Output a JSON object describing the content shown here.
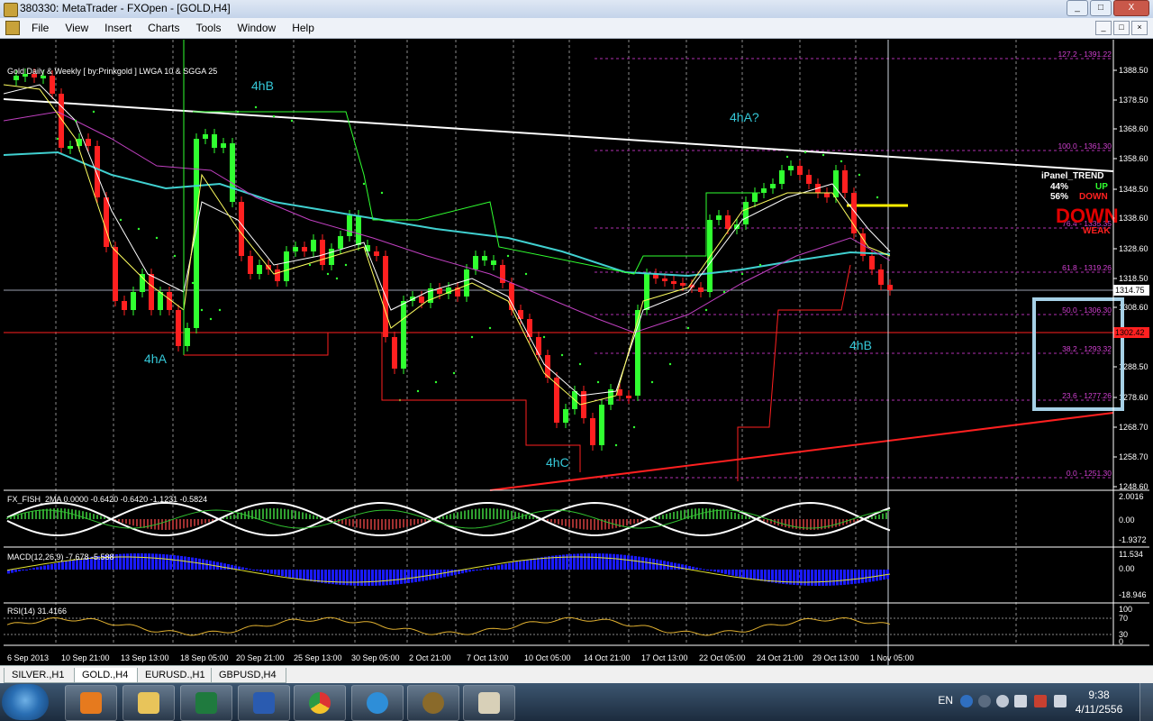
{
  "window": {
    "title": "380330: MetaTrader - FXOpen - [GOLD,H4]",
    "buttons": [
      "_",
      "□",
      "X"
    ]
  },
  "menu": {
    "items": [
      "File",
      "View",
      "Insert",
      "Charts",
      "Tools",
      "Window",
      "Help"
    ],
    "mdi_buttons": [
      "_",
      "□",
      "×"
    ]
  },
  "chart": {
    "header": "Gold Daily & Weekly [ by:Prinkgold ] LWGA 10  &  SGGA 25",
    "price_labels": [
      "1388.50",
      "1378.50",
      "1368.60",
      "1358.60",
      "1348.50",
      "1338.60",
      "1328.60",
      "1318.50",
      "1308.60",
      "1288.50",
      "1278.60",
      "1268.70",
      "1258.70",
      "1248.60"
    ],
    "current_price": "1314.75",
    "red_price_tag": "1302.42",
    "fib_labels": [
      "127.2 - 1391.22",
      "100.0 - 1361.30",
      "76.4 - 1335.35",
      "61.8 - 1319.26",
      "50.0 - 1306.30",
      "38.2 - 1293.32",
      "23.6 - 1277.26",
      "0.0 - 1251.30"
    ],
    "wave_labels": [
      "4hB",
      "4hA?",
      "4hA",
      "4hC",
      "4hB"
    ],
    "ipanel": {
      "title": "iPanel_TREND",
      "up_pct": "44%",
      "up_label": "UP",
      "down_pct": "56%",
      "down_label": "DOWN",
      "signal": "DOWN",
      "strength": "WEAK"
    },
    "time_labels": [
      "6 Sep 2013",
      "10 Sep 21:00",
      "13 Sep 13:00",
      "18 Sep 05:00",
      "20 Sep 21:00",
      "25 Sep 13:00",
      "30 Sep 05:00",
      "2 Oct 21:00",
      "7 Oct 13:00",
      "10 Oct 05:00",
      "14 Oct 21:00",
      "17 Oct 13:00",
      "22 Oct 05:00",
      "24 Oct 21:00",
      "29 Oct 13:00",
      "1 Nov 05:00"
    ]
  },
  "fisher": {
    "header": "FX_FISH_2MA 0.0000 -0.6420 -0.6420 -1.1231 -0.5824",
    "scale": [
      "2.0016",
      "0.00",
      "-1.9372"
    ]
  },
  "macd": {
    "header": "MACD(12,26,9) -7.678 -5.588",
    "scale": [
      "11.534",
      "0.00",
      "-18.946"
    ]
  },
  "rsi": {
    "header": "RSI(14) 31.4166",
    "scale": [
      "100",
      "70",
      "30",
      "0"
    ]
  },
  "tabs": [
    {
      "label": "SILVER.,H1",
      "active": false
    },
    {
      "label": "GOLD.,H4",
      "active": true
    },
    {
      "label": "EURUSD.,H1",
      "active": false
    },
    {
      "label": "GBPUSD,H4",
      "active": false
    }
  ],
  "taskbar": {
    "apps": [
      "media-player-icon",
      "file-explorer-icon",
      "excel-icon",
      "word-icon",
      "chrome-icon",
      "internet-explorer-icon",
      "metatrader-icon",
      "paint-icon"
    ],
    "language": "EN",
    "time": "9:38",
    "date": "4/11/2556"
  }
}
